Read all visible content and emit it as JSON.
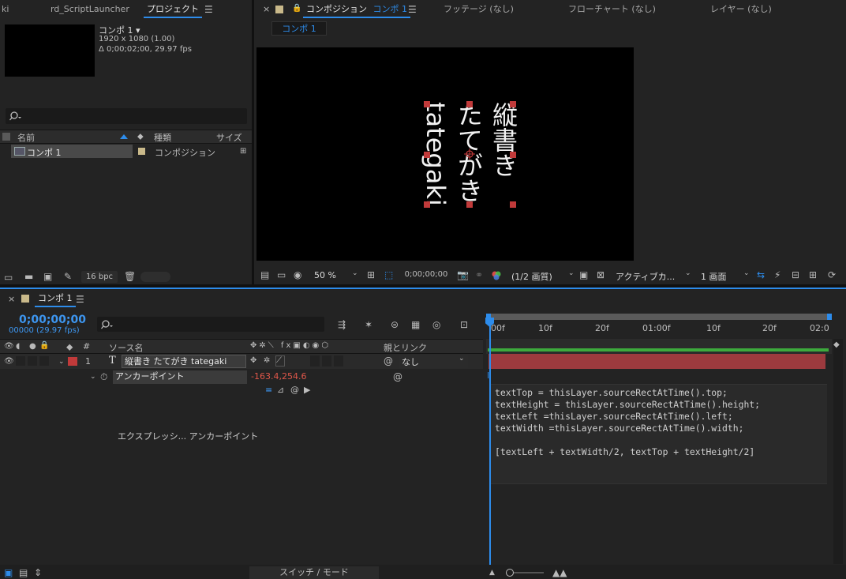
{
  "project_panel": {
    "tabs": [
      "ki",
      "rd_ScriptLauncher",
      "プロジェクト"
    ],
    "menu_icon": "hamburger-icon",
    "comp_name": "コンポ 1 ▾",
    "comp_resolution": "1920 x 1080 (1.00)",
    "comp_duration": "Δ 0;00;02;00, 29.97 fps",
    "search_icon": "search-icon",
    "columns": {
      "name": "名前",
      "type": "種類",
      "size": "サイズ"
    },
    "items": [
      {
        "name": "コンポ 1",
        "type": "コンポジション"
      }
    ],
    "bpc": "16 bpc"
  },
  "viewer": {
    "tabs": [
      "コンポジション",
      "コンポ 1",
      "フッテージ (なし)",
      "フローチャート (なし)",
      "レイヤー (なし)"
    ],
    "breadcrumb": "コンポ 1",
    "canvas_text": {
      "vertical_jp_1": "縦書き",
      "vertical_jp_2": "たてがき",
      "vertical_en": "tategaki"
    },
    "toolbar": {
      "zoom": "50 %",
      "timecode": "0;00;00;00",
      "resolution": "(1/2 画質)",
      "camera": "アクティブカ...",
      "views": "1 画面"
    }
  },
  "timeline": {
    "tab_label": "コンポ 1",
    "current_time": "0;00;00;00",
    "frame_info": "00000 (29.97 fps)",
    "columns": {
      "num": "#",
      "source": "ソース名",
      "parent": "親とリンク"
    },
    "layer": {
      "index": "1",
      "type_glyph": "T",
      "name": "縦書き たてがき tategaki",
      "parent": "なし",
      "label_color": "#c13a3a"
    },
    "property": {
      "name": "アンカーポイント",
      "value_x": "-163.4",
      "value_sep": ",",
      "value_y": "254.6"
    },
    "expression_label": "エクスプレッシ... アンカーポイント",
    "ruler": [
      "00f",
      "10f",
      "20f",
      "01:00f",
      "10f",
      "20f",
      "02:0"
    ],
    "expression_code": [
      "textTop = thisLayer.sourceRectAtTime().top;",
      "textHeight = thisLayer.sourceRectAtTime().height;",
      "textLeft =thisLayer.sourceRectAtTime().left;",
      "textWidth =thisLayer.sourceRectAtTime().width;",
      "",
      "[textLeft + textWidth/2, textTop + textHeight/2]"
    ],
    "footer": "スイッチ / モード",
    "accent_color": "#2d8ceb",
    "value_color": "#e0574a",
    "layer_bar_color": "#9c3a3e"
  }
}
